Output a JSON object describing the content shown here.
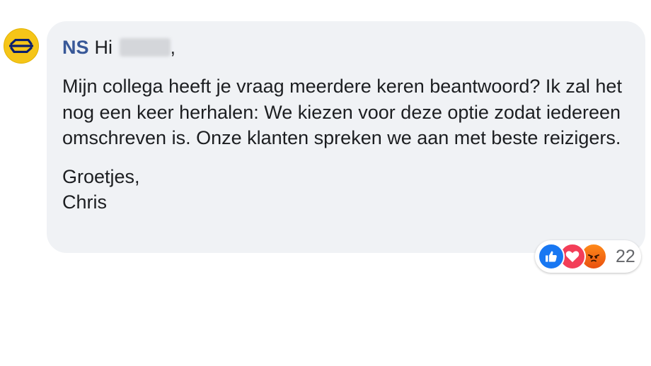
{
  "comment": {
    "author": "NS",
    "greeting": "Hi",
    "comma": ",",
    "body": "Mijn collega heeft je vraag meerdere keren beantwoord? Ik zal het nog een keer herhalen: We kiezen voor deze optie zodat iedereen omschreven is. Onze klanten spreken we aan met beste reizigers.",
    "signoff_line1": "Groetjes,",
    "signoff_line2": "Chris"
  },
  "avatar": {
    "icon": "ns-logo-icon",
    "color": "#f5c518"
  },
  "reactions": {
    "icons": [
      "like-icon",
      "love-icon",
      "angry-icon"
    ],
    "count": "22"
  }
}
